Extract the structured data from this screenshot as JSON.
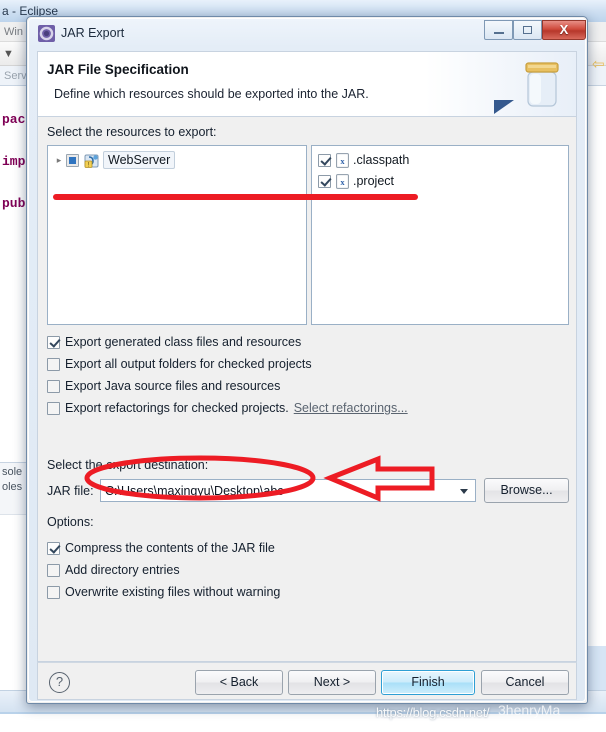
{
  "background": {
    "window_title": "a - Eclipse",
    "menu_text": "Win",
    "tab_text": "Serv",
    "code_lines": [
      "pack",
      "impo",
      "publ"
    ],
    "console_tab_1": "sole",
    "console_tab_2": "oles"
  },
  "dialog": {
    "title": "JAR Export",
    "title_icon": "jar-export-icon",
    "window_controls": {
      "minimize": "minimize-icon",
      "maximize": "maximize-icon",
      "close": "X"
    },
    "header": {
      "title": "JAR File Specification",
      "description": "Define which resources should be exported into the JAR.",
      "graphic": "jar-jar-icon"
    },
    "resources": {
      "label": "Select the resources to export:",
      "tree": [
        {
          "label": "WebServer",
          "check_state": "partial",
          "expander": "▸",
          "icon": "java-project-icon"
        }
      ],
      "files": [
        {
          "label": ".classpath",
          "check_state": "checked",
          "icon": "xml-file-icon"
        },
        {
          "label": ".project",
          "check_state": "checked",
          "icon": "xml-file-icon"
        }
      ]
    },
    "export_options": [
      {
        "label": "Export generated class files and resources",
        "checked": true
      },
      {
        "label": "Export all output folders for checked projects",
        "checked": false
      },
      {
        "label": "Export Java source files and resources",
        "checked": false
      },
      {
        "label": "Export refactorings for checked projects.",
        "checked": false,
        "link": "Select refactorings..."
      }
    ],
    "destination": {
      "label": "Select the export destination:",
      "jar_file_label": "JAR file:",
      "jar_file_value": "C:\\Users\\maxingyu\\Desktop\\abc",
      "jar_file_placeholder": "",
      "browse_label": "Browse..."
    },
    "options": {
      "label": "Options:",
      "items": [
        {
          "label": "Compress the contents of the JAR file",
          "checked": true
        },
        {
          "label": "Add directory entries",
          "checked": false
        },
        {
          "label": "Overwrite existing files without warning",
          "checked": false
        }
      ]
    },
    "buttons": {
      "help": "?",
      "back": "< Back",
      "next": "Next >",
      "finish": "Finish",
      "cancel": "Cancel"
    }
  },
  "annotations": {
    "color": "#ed1c24",
    "underline": "red-underline",
    "ellipse": "red-ellipse-around-jar-file-field",
    "arrow": "red-left-arrow"
  },
  "watermark": {
    "url": "https://blog.csdn.net/",
    "stamp": "3henryMa"
  }
}
